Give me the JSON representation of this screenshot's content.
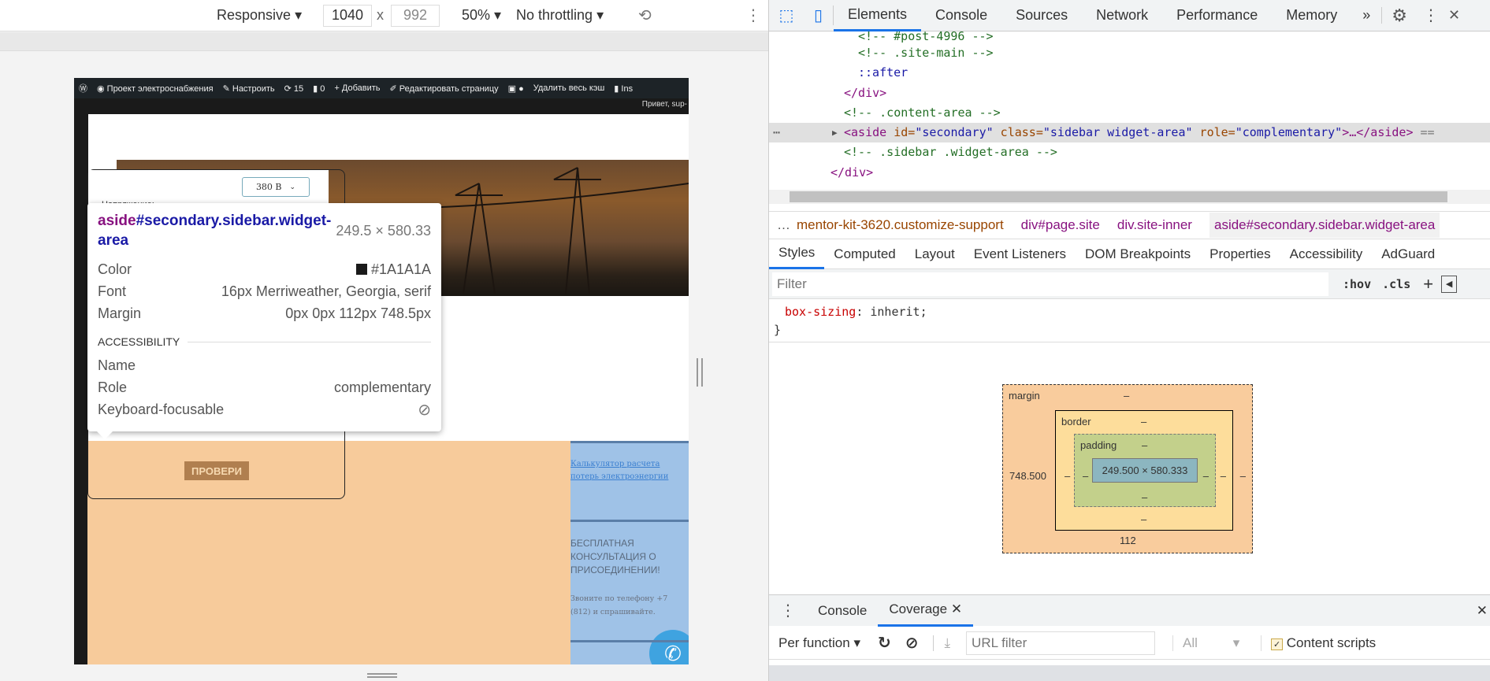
{
  "device_toolbar": {
    "mode": "Responsive",
    "width": "1040",
    "height": "992",
    "times": "x",
    "zoom": "50%",
    "throttling": "No throttling"
  },
  "page": {
    "adminbar": [
      "Проект электроснабжения",
      "Настроить",
      "15",
      "0",
      "Добавить",
      "Редактировать страницу",
      "Удалить весь кэш",
      "Ins"
    ],
    "greeting": "Привет, sup-",
    "voltage_label": "Напряжение:",
    "voltage_value": "380 В",
    "check_button": "ПРОВЕРИ",
    "sidebar_link": "Калькулятор расчета потерь электроэнергии",
    "consult_title": "БЕСПЛАТНАЯ КОНСУЛЬТАЦИЯ О ПРИСОЕДИНЕНИИ!",
    "consult_text": "Звоните по телефону +7 (812) и спрашивайте."
  },
  "inspector_popup": {
    "tag": "aside",
    "selector": "#secondary.sidebar.widget-area",
    "size": "249.5 × 580.33",
    "rows": [
      {
        "k": "Color",
        "v": "#1A1A1A"
      },
      {
        "k": "Font",
        "v": "16px Merriweather, Georgia, serif"
      },
      {
        "k": "Margin",
        "v": "0px 0px 112px 748.5px"
      }
    ],
    "accessibility_title": "ACCESSIBILITY",
    "a11y": [
      {
        "k": "Name",
        "v": ""
      },
      {
        "k": "Role",
        "v": "complementary"
      },
      {
        "k": "Keyboard-focusable",
        "v": ""
      }
    ]
  },
  "devtools": {
    "tabs": [
      "Elements",
      "Console",
      "Sources",
      "Network",
      "Performance",
      "Memory"
    ],
    "active_tab": "Elements",
    "dom": {
      "l0": "<!-- #post-4996 -->",
      "l1": "<!-- .site-main -->",
      "l2": "::after",
      "l3": "</div>",
      "l4": "<!-- .content-area -->",
      "sel_tag": "<aside",
      "sel_id_attr": " id=",
      "sel_id_val": "\"secondary\"",
      "sel_class_attr": " class=",
      "sel_class_val": "\"sidebar widget-area\"",
      "sel_role_attr": " role=",
      "sel_role_val": "\"complementary\"",
      "sel_end": ">…</aside>",
      "sel_eq": " ==",
      "l6": "<!-- .sidebar .widget-area -->",
      "l7": "</div>"
    },
    "breadcrumbs": [
      "mentor-kit-3620.customize-support",
      "div#page.site",
      "div.site-inner",
      "aside#secondary.sidebar.widget-area"
    ],
    "subtabs": [
      "Styles",
      "Computed",
      "Layout",
      "Event Listeners",
      "DOM Breakpoints",
      "Properties",
      "Accessibility",
      "AdGuard"
    ],
    "filter_placeholder": "Filter",
    "hov": ":hov",
    "cls": ".cls",
    "css": {
      "prop": "box-sizing",
      "value": "inherit"
    },
    "box_model": {
      "margin_label": "margin",
      "border_label": "border",
      "padding_label": "padding",
      "dash": "–",
      "margin_left": "748.500",
      "margin_bottom": "112",
      "content": "249.500 × 580.333"
    },
    "drawer": {
      "tabs": [
        "Console",
        "Coverage"
      ],
      "active": "Coverage",
      "mode": "Per function",
      "url_placeholder": "URL filter",
      "type": "All",
      "content_scripts": "Content scripts",
      "content_scripts_checked": true
    }
  }
}
